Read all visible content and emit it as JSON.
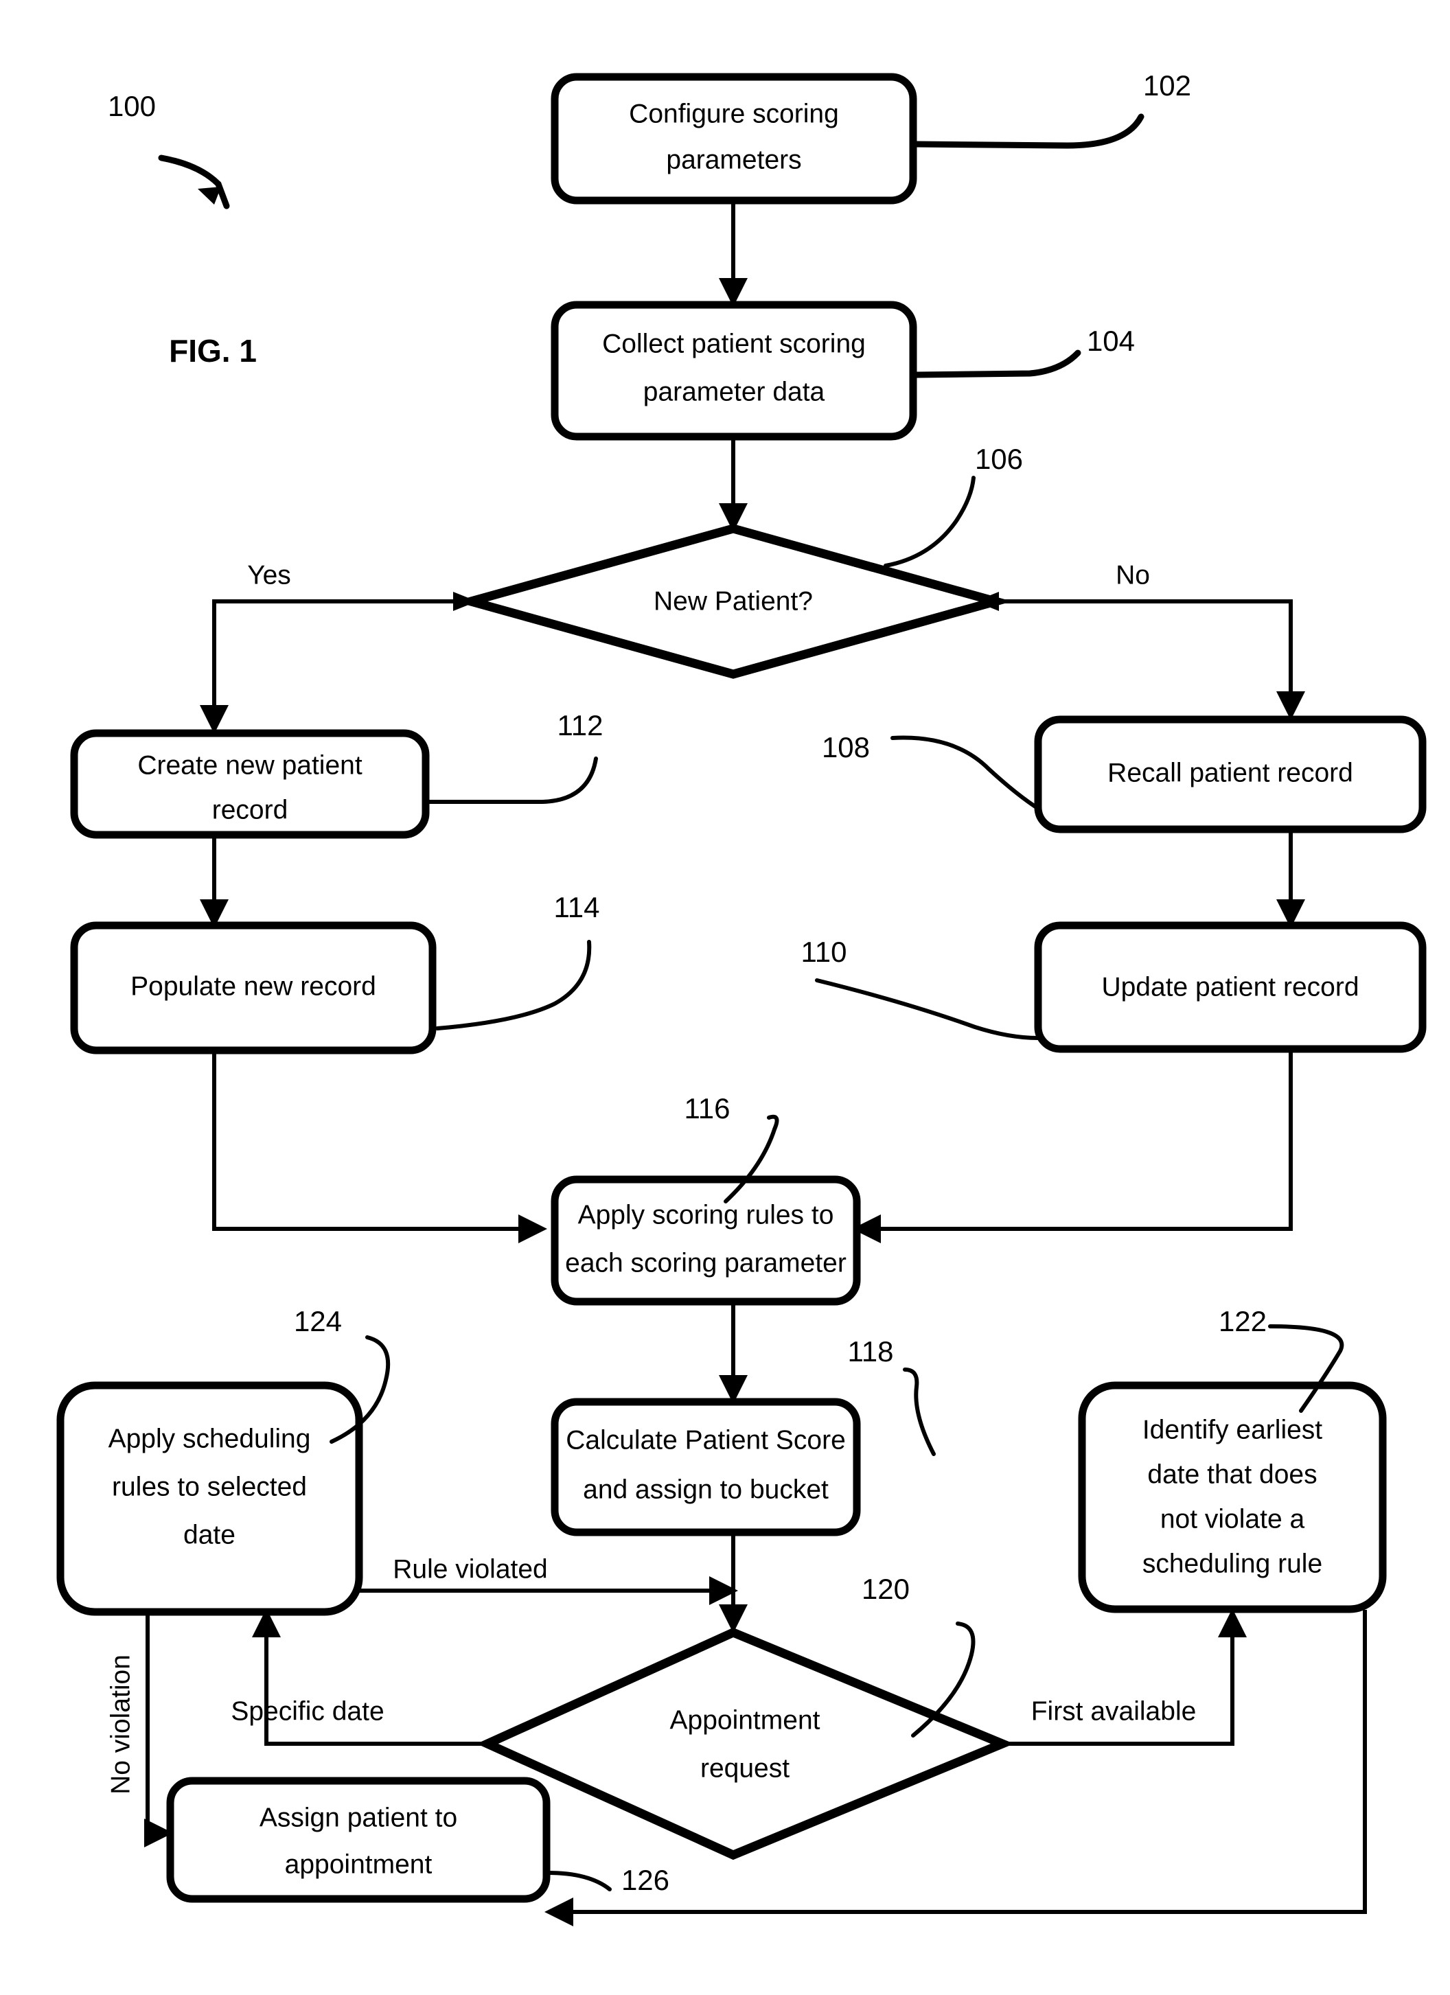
{
  "figure": {
    "caption": "FIG. 1",
    "system_ref": "100"
  },
  "nodes": [
    {
      "id": "n102",
      "ref": "102",
      "type": "process",
      "lines": [
        "Configure scoring",
        "parameters"
      ]
    },
    {
      "id": "n104",
      "ref": "104",
      "type": "process",
      "lines": [
        "Collect patient scoring",
        "parameter data"
      ]
    },
    {
      "id": "n106",
      "ref": "106",
      "type": "decision",
      "lines": [
        "New Patient?"
      ]
    },
    {
      "id": "n112",
      "ref": "112",
      "type": "process",
      "lines": [
        "Create new patient",
        "record"
      ]
    },
    {
      "id": "n114",
      "ref": "114",
      "type": "process",
      "lines": [
        "Populate new record"
      ]
    },
    {
      "id": "n108",
      "ref": "108",
      "type": "process",
      "lines": [
        "Recall patient record"
      ]
    },
    {
      "id": "n110",
      "ref": "110",
      "type": "process",
      "lines": [
        "Update patient record"
      ]
    },
    {
      "id": "n116",
      "ref": "116",
      "type": "process",
      "lines": [
        "Apply scoring rules to",
        "each scoring parameter"
      ]
    },
    {
      "id": "n118",
      "ref": "118",
      "type": "process",
      "lines": [
        "Calculate Patient Score",
        "and assign to bucket"
      ]
    },
    {
      "id": "n124",
      "ref": "124",
      "type": "process",
      "lines": [
        "Apply scheduling",
        "rules to selected",
        "date"
      ]
    },
    {
      "id": "n122",
      "ref": "122",
      "type": "process",
      "lines": [
        "Identify earliest",
        "date that does",
        "not violate a",
        "scheduling rule"
      ]
    },
    {
      "id": "n120",
      "ref": "120",
      "type": "decision",
      "lines": [
        "Appointment",
        "request"
      ]
    },
    {
      "id": "n126",
      "ref": "126",
      "type": "process",
      "lines": [
        "Assign patient to",
        "appointment"
      ]
    }
  ],
  "edge_labels": {
    "yes": "Yes",
    "no": "No",
    "rule_violated": "Rule violated",
    "specific_date": "Specific date",
    "first_available": "First available",
    "no_violation": "No violation"
  },
  "reference_numerals": [
    "100",
    "102",
    "104",
    "106",
    "108",
    "110",
    "112",
    "114",
    "116",
    "118",
    "120",
    "122",
    "124",
    "126"
  ],
  "colors": {
    "stroke": "#000000",
    "fill": "#ffffff"
  }
}
